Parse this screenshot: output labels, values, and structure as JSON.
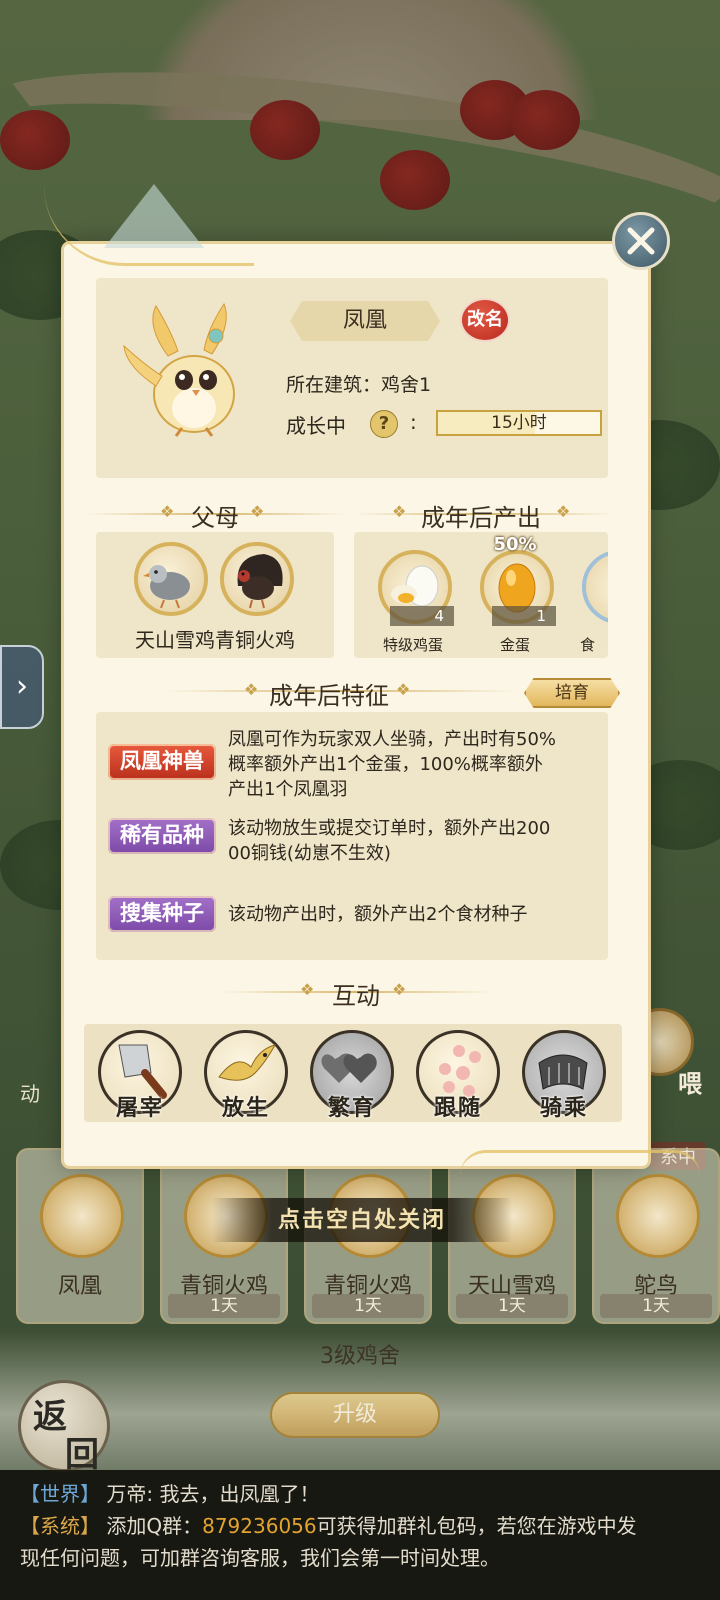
{
  "modal": {
    "animal_name": "凤凰",
    "rename_label": "改名",
    "building_line": "所在建筑：鸡舍1",
    "growth_label": "成长中",
    "growth_help": "?",
    "growth_colon": ":",
    "growth_remaining": "15小时",
    "growth_progress": 0.6,
    "parents_title": "父母",
    "parents_names": "天山雪鸡青铜火鸡",
    "outputs_title": "成年后产出",
    "outputs": [
      {
        "name": "特级鸡蛋",
        "count": "4",
        "percent": ""
      },
      {
        "name": "金蛋",
        "count": "1",
        "percent": "50%"
      },
      {
        "name": "食",
        "count": "",
        "percent": ""
      }
    ],
    "traits_title": "成年后特征",
    "breed_label": "培育",
    "traits": [
      {
        "tag": "凤凰神兽",
        "color": "#d2412a",
        "desc_lines": [
          "凤凰可作为玩家双人坐骑，产出时有50%",
          "概率额外产出1个金蛋，100%概率额外",
          "产出1个凤凰羽"
        ]
      },
      {
        "tag": "稀有品种",
        "color": "#8e5ab8",
        "desc_lines": [
          "该动物放生或提交订单时，额外产出200",
          "00铜钱(幼崽不生效)"
        ]
      },
      {
        "tag": "搜集种子",
        "color": "#8e5ab8",
        "desc_lines": [
          "该动物产出时，额外产出2个食材种子"
        ]
      }
    ],
    "interact_title": "互动",
    "interactions": [
      {
        "label": "屠宰",
        "icon": "cleaver-icon"
      },
      {
        "label": "放生",
        "icon": "bird-release-icon"
      },
      {
        "label": "繁育",
        "icon": "hearts-icon"
      },
      {
        "label": "跟随",
        "icon": "paw-icon"
      },
      {
        "label": "骑乘",
        "icon": "saddle-icon"
      }
    ]
  },
  "tap_to_close": "点击空白处关闭",
  "animal_list": [
    {
      "name": "凤凰",
      "duration": ""
    },
    {
      "name": "青铜火鸡",
      "duration": "1天"
    },
    {
      "name": "青铜火鸡",
      "duration": "1天"
    },
    {
      "name": "天山雪鸡",
      "duration": "1天"
    },
    {
      "name": "鸵鸟",
      "duration": "1天"
    }
  ],
  "building_level": "3级鸡舍",
  "upgrade_label": "升级",
  "back_label": [
    "返",
    "回"
  ],
  "peek_label": "动",
  "peek_chip": "系中",
  "side_label": "喂",
  "chat": {
    "line1_tag": "【世界】",
    "line1_text": "万帝: 我去，出凤凰了！",
    "line2_tag": "【系统】",
    "line2_pre": "添加Q群：",
    "line2_qq": "879236056",
    "line2_post": "可获得加群礼包码，若您在游戏中发",
    "line3": "现任何问题，可加群咨询客服，我们会第一时间处理。"
  },
  "colors": {
    "accent_gold": "#d7b25c",
    "panel_bg": "#efe6c9",
    "modal_bg": "#fbf6e6",
    "rename_red": "#c9321f"
  }
}
